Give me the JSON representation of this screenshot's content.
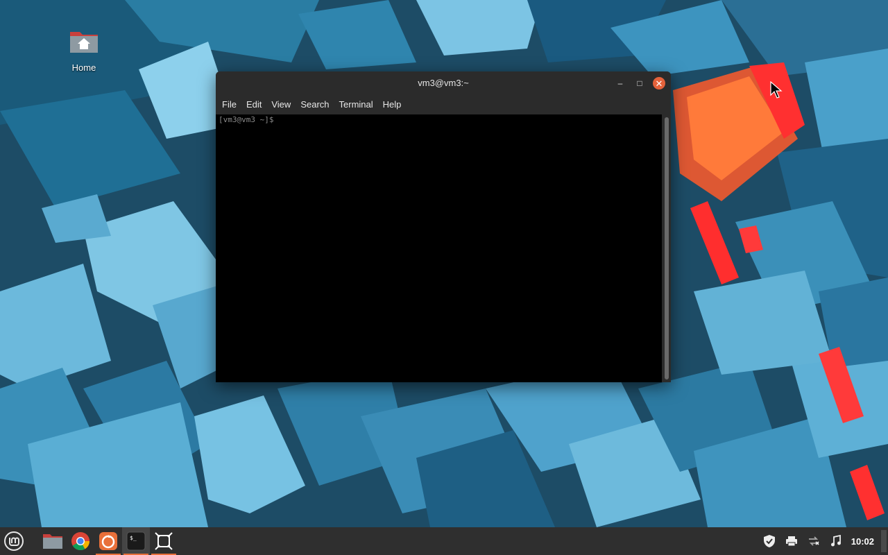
{
  "desktop": {
    "icons": [
      {
        "label": "Home",
        "icon": "home-folder-icon"
      }
    ]
  },
  "terminal": {
    "title": "vm3@vm3:~",
    "menu": [
      "File",
      "Edit",
      "View",
      "Search",
      "Terminal",
      "Help"
    ],
    "prompt": "[vm3@vm3 ~]$",
    "controls": {
      "minimize": "–",
      "maximize": "□",
      "close": "✕"
    }
  },
  "taskbar": {
    "launchers": [
      {
        "name": "menu-button",
        "icon": "linux-mint-logo-icon"
      },
      {
        "name": "files-launcher",
        "icon": "folder-icon"
      },
      {
        "name": "chrome-launcher",
        "icon": "chrome-icon"
      },
      {
        "name": "firefox-launcher",
        "icon": "firefox-icon"
      },
      {
        "name": "terminal-launcher",
        "icon": "terminal-icon"
      },
      {
        "name": "app-launcher",
        "icon": "frame-icon"
      }
    ],
    "tray": {
      "icons": [
        "shield-icon",
        "printer-icon",
        "network-icon",
        "sound-icon"
      ],
      "clock": "10:02"
    }
  },
  "colors": {
    "accent": "#e8703a",
    "close_button": "#e5623b",
    "panel": "#2f2f2f",
    "window": "#2b2b2b"
  }
}
